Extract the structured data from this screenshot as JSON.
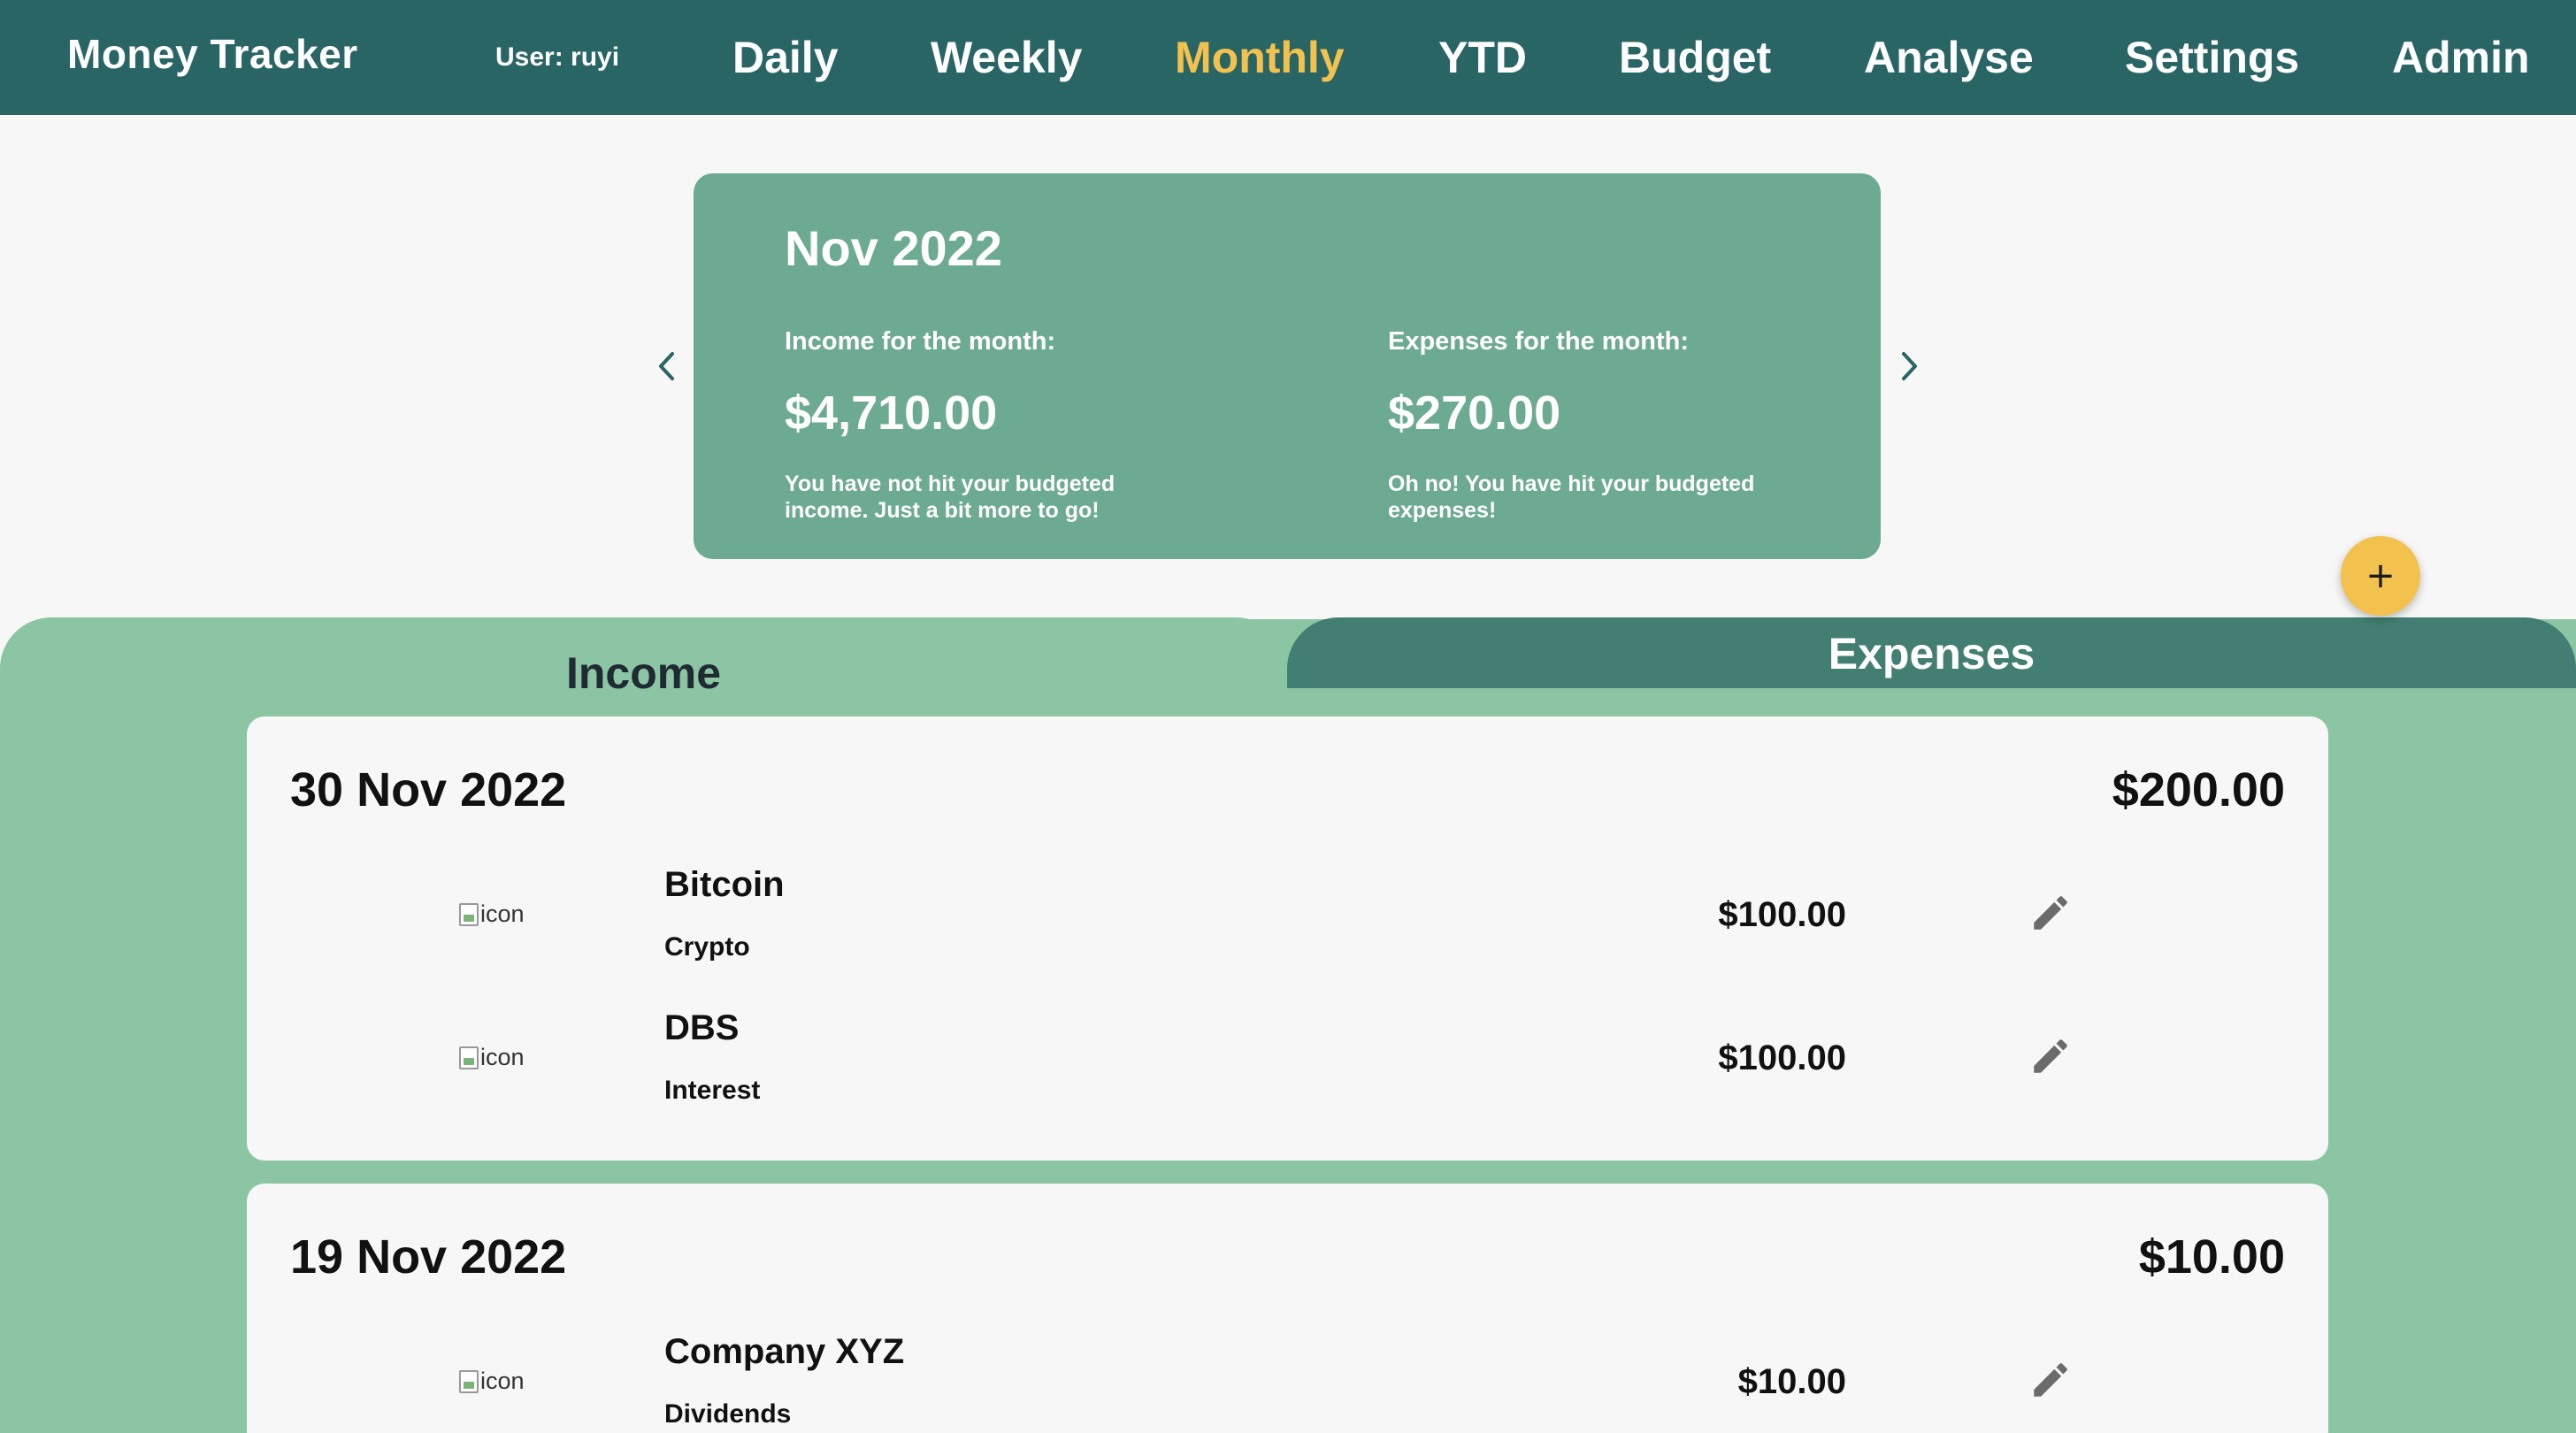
{
  "nav": {
    "brand": "Money Tracker",
    "user": "User: ruyi",
    "links": [
      "Daily",
      "Weekly",
      "Monthly",
      "YTD",
      "Budget",
      "Analyse",
      "Settings",
      "Admin"
    ],
    "active": "Monthly",
    "active_color": "#f2c14e",
    "bg_color": "#2a6566"
  },
  "summary": {
    "month": "Nov 2022",
    "income_label": "Income for the month:",
    "income_amount": "$4,710.00",
    "income_note": "You have not hit your budgeted income. Just a bit more to go!",
    "expenses_label": "Expenses for the month:",
    "expenses_amount": "$270.00",
    "expenses_note": "Oh no! You have hit your budgeted expenses!",
    "prev_icon": "chevron-left-icon",
    "next_icon": "chevron-right-icon",
    "bg_color": "#6daa92"
  },
  "fab": {
    "label": "+",
    "icon": "plus-icon",
    "color": "#f2c14e"
  },
  "tabs": {
    "income": "Income",
    "expenses": "Expenses",
    "active": "Income"
  },
  "days": [
    {
      "date": "30 Nov 2022",
      "total": "$200.00",
      "entries": [
        {
          "icon_alt": "icon",
          "name": "Bitcoin",
          "category": "Crypto",
          "amount": "$100.00"
        },
        {
          "icon_alt": "icon",
          "name": "DBS",
          "category": "Interest",
          "amount": "$100.00"
        }
      ]
    },
    {
      "date": "19 Nov 2022",
      "total": "$10.00",
      "entries": [
        {
          "icon_alt": "icon",
          "name": "Company XYZ",
          "category": "Dividends",
          "amount": "$10.00"
        }
      ]
    }
  ]
}
